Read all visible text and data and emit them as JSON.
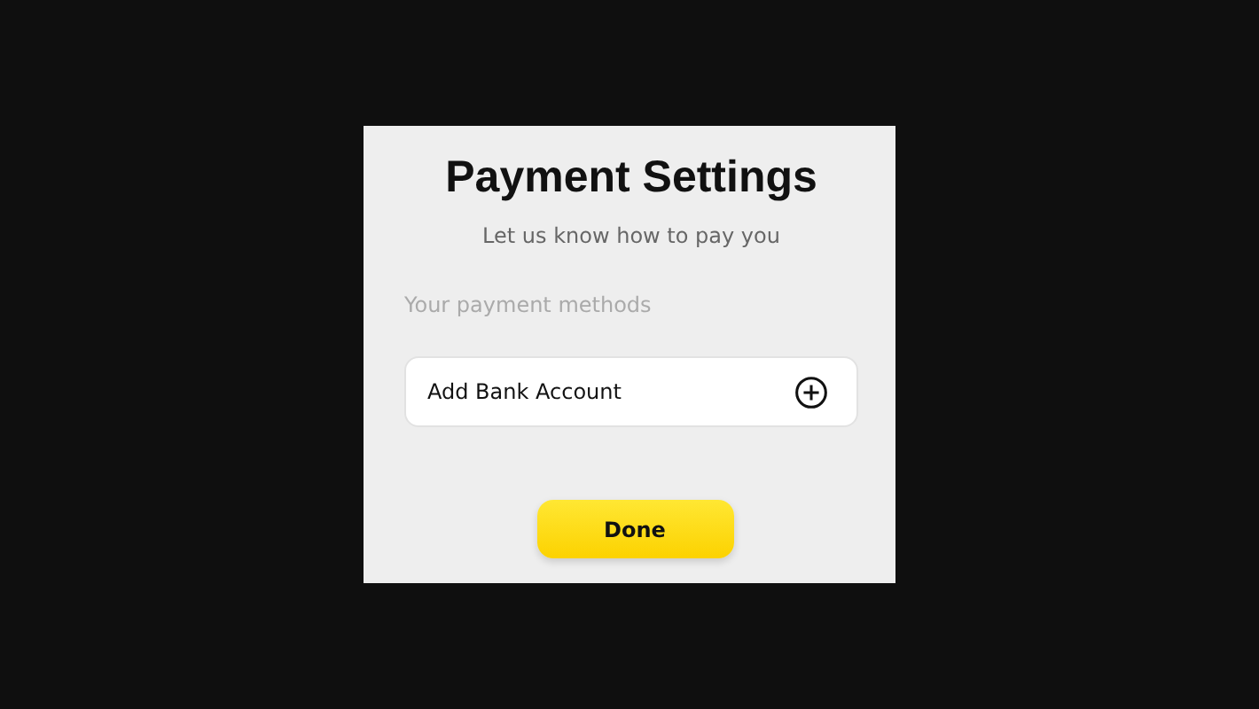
{
  "dialog": {
    "title": "Payment Settings",
    "subtitle": "Let us know how to pay you",
    "section_label": "Your payment methods",
    "methods": [
      {
        "label": "Add Bank Account"
      }
    ],
    "button": "Done"
  }
}
